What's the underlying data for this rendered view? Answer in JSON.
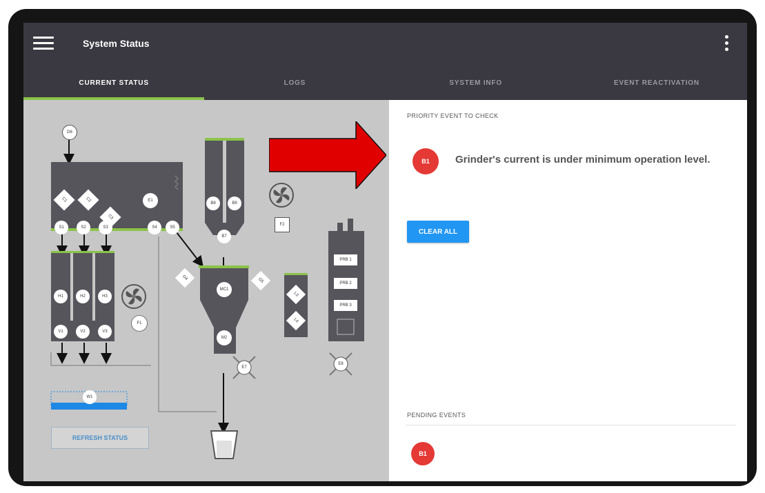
{
  "app": {
    "title": "System Status"
  },
  "tabs": [
    {
      "label": "CURRENT STATUS",
      "active": true
    },
    {
      "label": "LOGS",
      "active": false
    },
    {
      "label": "SYSTEM INFO",
      "active": false
    },
    {
      "label": "EVENT REACTIVATION",
      "active": false
    }
  ],
  "priority": {
    "section_label": "PRIORITY EVENT TO CHECK",
    "badge": "B1",
    "message": "Grinder's current is under minimum operation level."
  },
  "clear_all_label": "CLEAR ALL",
  "pending": {
    "section_label": "PENDING EVENTS",
    "badge": "B1"
  },
  "refresh_label": "REFRESH STATUS",
  "diagram": {
    "top_left_node": "D6",
    "top_diamonds": [
      "C1",
      "C2",
      "C3"
    ],
    "mix_node": "E1",
    "lower_row_circles": [
      "S1",
      "S2",
      "S3",
      "S4",
      "S5"
    ],
    "hopper_circles": [
      "H1",
      "H2",
      "H3"
    ],
    "valve_circles": [
      "V1",
      "V2",
      "V3"
    ],
    "fan_left_label": "F1",
    "center_column_circles": [
      "B8",
      "B9"
    ],
    "center_mid_circle": "B7",
    "fan_right_label": "F2",
    "grinder_left_diamond": "G4",
    "grinder_right_diamond": "G5",
    "grinder_top_circle": "MC1",
    "grinder_bottom_circle": "M2",
    "x_nodes": [
      "E7",
      "E8"
    ],
    "small_box_diamonds": [
      "L3",
      "L4"
    ],
    "tall_box_labels": [
      "PRB 1",
      "PRB 2",
      "PRB 3"
    ],
    "water_node": "W1"
  },
  "colors": {
    "appbar": "#3a3941",
    "active_tab_indicator": "#8bc34a",
    "badge": "#e53935",
    "primary_button": "#2196f3",
    "annotation_arrow": "#e00000"
  },
  "icons": {
    "menu": "hamburger-menu-icon",
    "overflow": "more-vertical-icon",
    "fan": "fan-icon",
    "cup": "cup-icon",
    "arrow": "red-arrow-annotation"
  }
}
